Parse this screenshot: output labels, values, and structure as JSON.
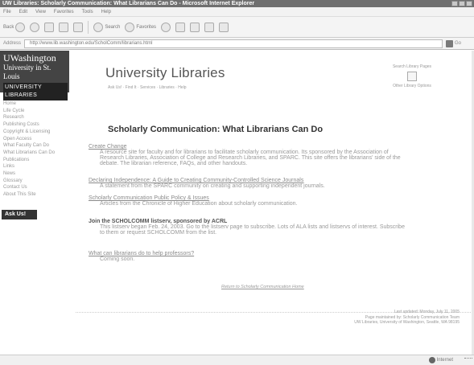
{
  "window": {
    "title": "UW Libraries: Scholarly Communication: What Librarians Can Do - Microsoft Internet Explorer"
  },
  "menubar": {
    "items": [
      "File",
      "Edit",
      "View",
      "Favorites",
      "Tools",
      "Help"
    ]
  },
  "toolbar": {
    "back_label": "Back",
    "search_label": "Search",
    "favorites_label": "Favorites"
  },
  "addressbar": {
    "label": "Address",
    "url": "http://www.lib.washington.edu/ScholComm/librarians.html",
    "go_label": "Go"
  },
  "sidebar": {
    "logo_line1": "UWashington",
    "logo_line2": "University in St. Louis",
    "logo_line3": "UNIVERSITY LIBRARIES",
    "nav_items": [
      "Home",
      "Life Cycle",
      "Research",
      "Publishing Costs",
      "Copyright & Licensing",
      "Open Access",
      "What Faculty Can Do",
      "What Librarians Can Do",
      "Publications",
      "Links",
      "News",
      "Glossary",
      "Contact Us",
      "About This Site"
    ],
    "ask_label": "Ask Us!"
  },
  "header": {
    "title": "University Libraries",
    "sub": "Ask Us! · Find It · Services · Libraries · Help",
    "right_label1": "Search Library Pages",
    "right_label2": "Other Library Options"
  },
  "page": {
    "title": "Scholarly Communication: What Librarians Can Do",
    "sections": [
      {
        "head": "Create Change",
        "body": "A resource site for faculty and for librarians to facilitate scholarly communication. Its sponsored by the Association of Research Libraries, Association of College and Research Libraries, and SPARC. This site offers the librarians' side of the debate. The librarian reference, FAQs, and other handouts."
      },
      {
        "head": "Declaring Independence: A Guide to Creating Community-Controlled Science Journals",
        "body": "A statement from the SPARC community on creating and supporting independent journals."
      },
      {
        "head": "Scholarly Communication Public Policy & Issues",
        "body": "Articles from the Chronicle of Higher Education about scholarly communication."
      },
      {
        "head": "Join the SCHOLCOMM listserv, sponsored by ACRL",
        "body": "This listserv began Feb. 24, 2003. Go to the listserv page to subscribe. Lots of ALA lists and listservs of interest. Subscribe to them or request SCHOLCOMM from the list."
      },
      {
        "head": "What can librarians do to help professors?",
        "body": "Coming soon."
      }
    ],
    "return_link": "Return to Scholarly Communication Home",
    "footer_lines": [
      "Last updated: Monday, July 11, 2005",
      "Page maintained by: Scholarly Communication Team",
      "UW Libraries, University of Washington, Seattle, WA 98195"
    ]
  },
  "statusbar": {
    "zone": "Internet"
  }
}
